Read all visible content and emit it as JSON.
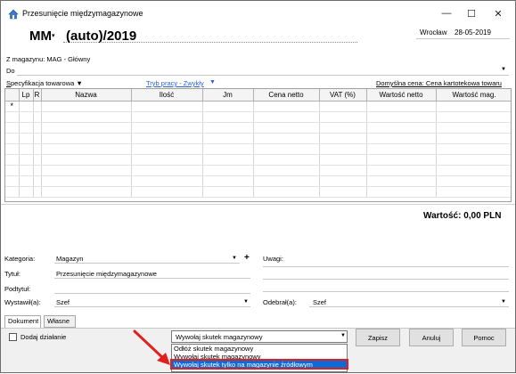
{
  "window": {
    "title": "Przesunięcie międzymagazynowe",
    "minimize_glyph": "—",
    "maximize_glyph": "☐",
    "close_glyph": "✕"
  },
  "header": {
    "doc_type": "MM",
    "doc_type_arrow": "▾",
    "doc_number": "(auto)/2019",
    "place": "Wrocław",
    "date": "28-05-2019"
  },
  "warehouses": {
    "from_label": "Z magazynu: MAG - Główny",
    "to_label": "Do",
    "to_arrow": "▼"
  },
  "spec": {
    "label_first_letter": "S",
    "label_rest": "pecyfikacja towarowa",
    "label_arrow": "▼",
    "mode_link": "Tryb pracy - Zwykły",
    "mode_arrow": "▼",
    "price_link": "Domyślna cena: Cena kartotekowa towaru"
  },
  "grid": {
    "columns": [
      "",
      "Lp",
      "R",
      "Nazwa",
      "Ilość",
      "Jm",
      "Cena netto",
      "VAT (%)",
      "Wartość netto",
      "Wartość mag."
    ],
    "new_row_marker": "*"
  },
  "total": "Wartość: 0,00 PLN",
  "form": {
    "category_label": "Kategoria:",
    "category_value": "Magazyn",
    "category_add": "+",
    "title_label": "Tytuł:",
    "title_value": "Przesunięcie międzymagazynowe",
    "subtitle_label": "Podtytuł:",
    "issued_label": "Wystawił(a):",
    "issued_value": "Szef",
    "received_label": "Odebrał(a):",
    "received_value": "Szef",
    "notes_label": "Uwagi:",
    "dropdown_arrow": "▼"
  },
  "tabs": [
    "Dokument",
    "Własne"
  ],
  "bottom": {
    "add_action_label": "Dodaj działanie",
    "effect_selected": "Wywołaj skutek magazynowy",
    "effect_options": [
      "Odłóż skutek magazynowy",
      "Wywołaj skutek magazynowy",
      "Wywołaj skutek tylko na magazynie źródłowym"
    ],
    "effect_arrow": "▼",
    "save_label": "Zapisz",
    "cancel_label": "Anuluj",
    "help_label": "Pomoc"
  },
  "colors": {
    "link": "#2a62d6",
    "selection": "#0d6bd8",
    "annotation": "#e02020"
  }
}
